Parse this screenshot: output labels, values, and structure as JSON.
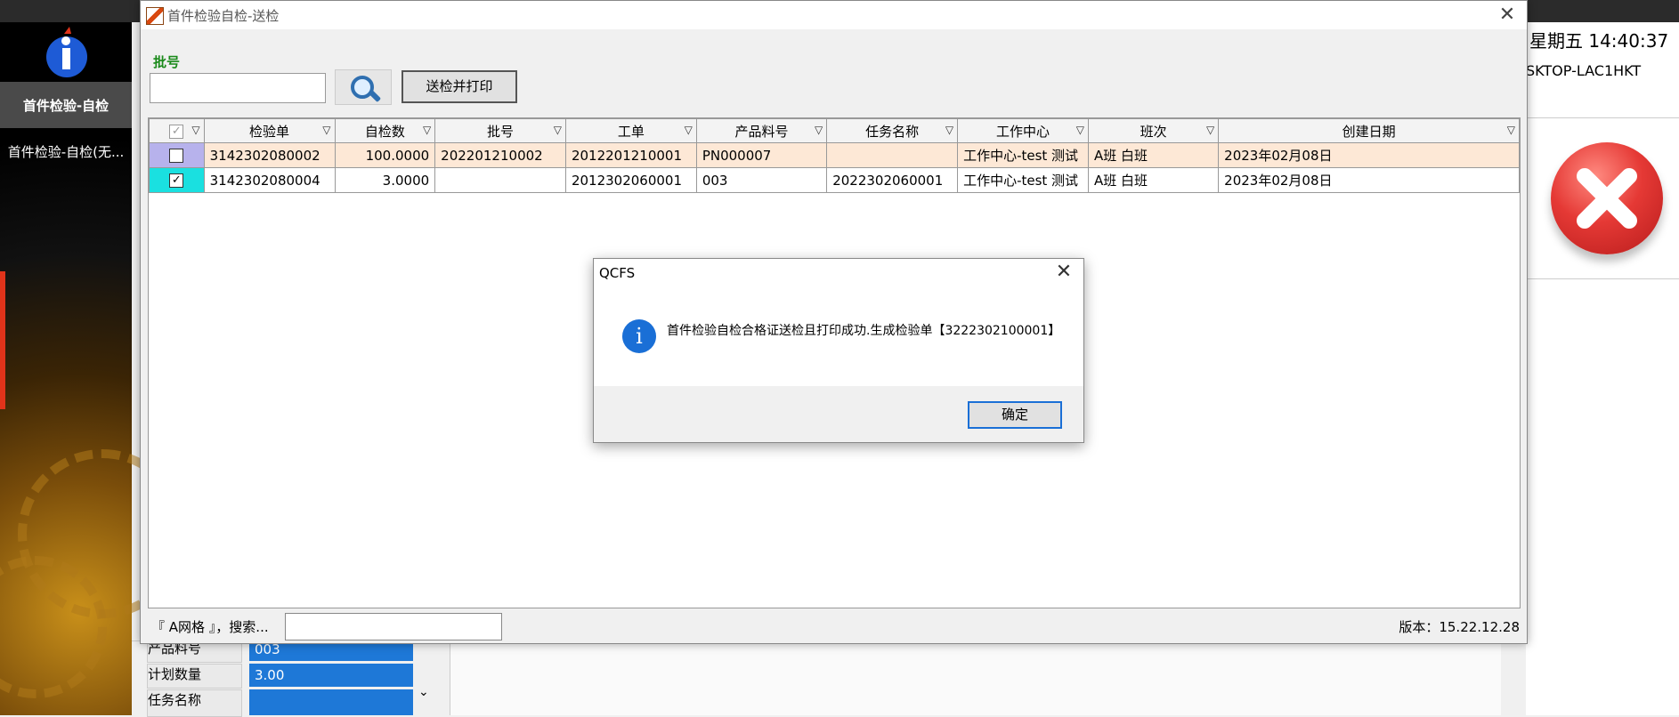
{
  "background": {
    "nav_active": "首件检验-自检",
    "nav_item": "首件检验-自检(无...",
    "clock": "星期五 14:40:37",
    "host": "SKTOP-LAC1HKT",
    "fields": [
      {
        "label": "产品料号",
        "value": "003"
      },
      {
        "label": "计划数量",
        "value": "3.00"
      },
      {
        "label": "任务名称",
        "value": ""
      }
    ]
  },
  "window": {
    "title": "首件检验自检-送检",
    "batch_label": "批号",
    "batch_value": "",
    "print_button": "送检并打印",
    "columns": [
      "检验单",
      "自检数",
      "批号",
      "工单",
      "产品料号",
      "任务名称",
      "工作中心",
      "班次",
      "创建日期"
    ],
    "rows": [
      {
        "checked": false,
        "cells": [
          "3142302080002",
          "100.0000",
          "202201210002",
          "2012201210001",
          "PN000007",
          "",
          "工作中心-test 测试",
          "A班 白班",
          "2023年02月08日"
        ]
      },
      {
        "checked": true,
        "cells": [
          "3142302080004",
          "3.0000",
          "",
          "2012302060001",
          "003",
          "2022302060001",
          "工作中心-test 测试",
          "A班 白班",
          "2023年02月08日"
        ]
      }
    ],
    "status_label": "『 A网格 』，搜索...",
    "version": "版本：15.22.12.28"
  },
  "dialog": {
    "title": "QCFS",
    "message": "首件检验自检合格证送检且打印成功.生成检验单【3222302100001】",
    "ok": "确定"
  },
  "colors": {
    "accent": "#1a6fd6",
    "row_highlight": "#fde8d6",
    "checked_cell": "#1ae0e0"
  }
}
